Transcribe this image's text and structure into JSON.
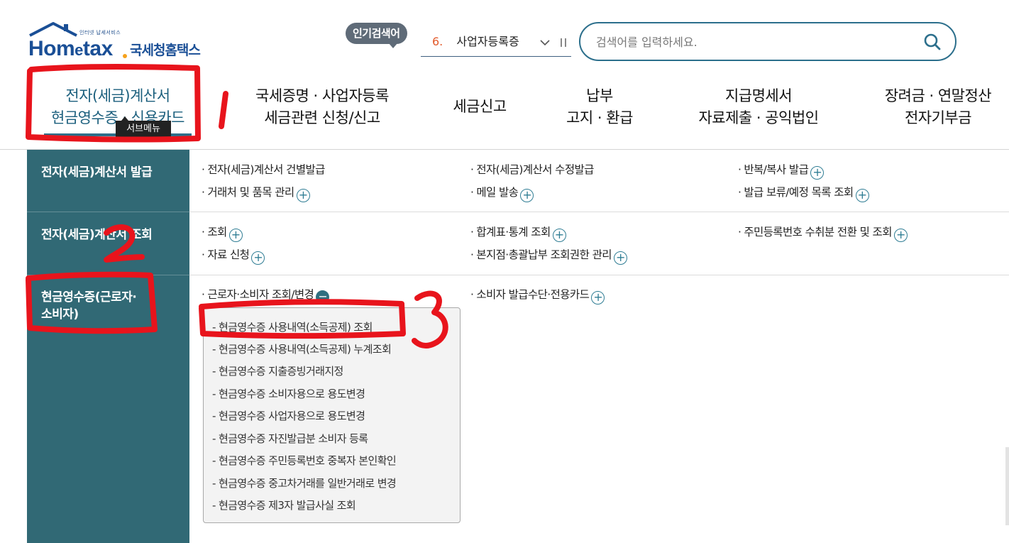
{
  "header": {
    "logo": {
      "tagline": "인터넷 납세서비스",
      "brand": "Hometax",
      "name": "국세청홈택스"
    },
    "popular": {
      "badge": "인기검색어",
      "rank": "6.",
      "term": "사업자등록증",
      "toggle_icon": "chevron-down-icon",
      "pause_icon": "pause-icon"
    },
    "search": {
      "placeholder": "검색어를 입력하세요.",
      "icon": "search-icon"
    }
  },
  "gnb": {
    "tabs": [
      {
        "line1": "전자(세금)계산서",
        "line2": "현금영수증 · 신용카드",
        "active": true
      },
      {
        "line1": "국세증명 · 사업자등록",
        "line2": "세금관련 신청/신고"
      },
      {
        "line1": "세금신고",
        "line2": ""
      },
      {
        "line1": "납부",
        "line2": "고지 · 환급"
      },
      {
        "line1": "지급명세서",
        "line2": "자료제출 · 공익법인"
      },
      {
        "line1": "장려금 · 연말정산",
        "line2": "전자기부금"
      }
    ],
    "tooltip": "서브메뉴"
  },
  "submenu": {
    "sections": [
      {
        "category": "전자(세금)계산서 발급",
        "items": [
          {
            "label": "전자(세금)계산서 건별발급",
            "expand": false
          },
          {
            "label": "전자(세금)계산서 수정발급",
            "expand": false
          },
          {
            "label": "반복/복사 발급",
            "expand": true
          },
          {
            "label": "거래처 및 품목 관리",
            "expand": true
          },
          {
            "label": "메일 발송",
            "expand": true
          },
          {
            "label": "발급 보류/예정 목록 조회",
            "expand": true
          }
        ]
      },
      {
        "category": "전자(세금)계산서 조회",
        "items": [
          {
            "label": "조회",
            "expand": true
          },
          {
            "label": "합계표·통계 조회",
            "expand": true
          },
          {
            "label": "주민등록번호 수취분 전환 및 조회",
            "expand": true
          },
          {
            "label": "자료 신청",
            "expand": true
          },
          {
            "label": "본지점·총괄납부 조회권한 관리",
            "expand": true
          }
        ]
      },
      {
        "category_line1": "현금영수증(근로자·",
        "category_line2": "소비자)",
        "items": [
          {
            "label": "근로자·소비자 조회/변경",
            "expanded": true
          },
          {
            "label": "소비자 발급수단·전용카드",
            "expand": true
          }
        ],
        "dropdown": [
          "현금영수증 사용내역(소득공제) 조회",
          "현금영수증 사용내역(소득공제) 누계조회",
          "현금영수증 지출증빙거래지정",
          "현금영수증 소비자용으로 용도변경",
          "현금영수증 사업자용으로 용도변경",
          "현금영수증 자진발급분 소비자 등록",
          "현금영수증 주민등록번호 중복자 본인확인",
          "현금영수증 중고차거래를 일반거래로 변경",
          "현금영수증 제3자 발급사실 조회"
        ]
      }
    ]
  },
  "annotations": {
    "color": "#e8141c",
    "marks": [
      "1",
      "2",
      "3"
    ]
  }
}
